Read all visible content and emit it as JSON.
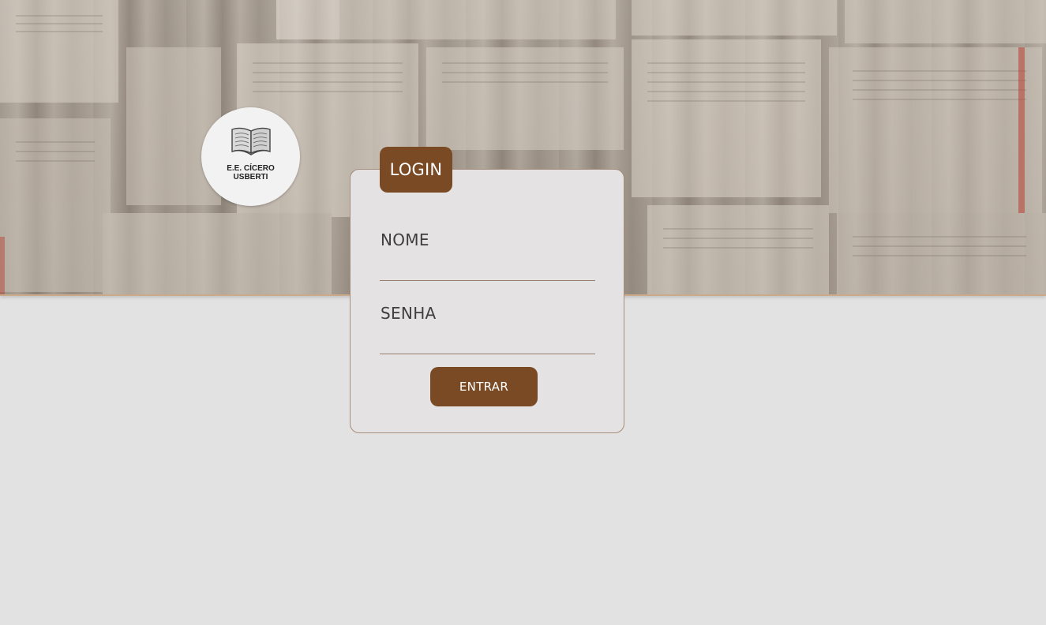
{
  "hero": {
    "background_icon": "open-books-photo"
  },
  "logo": {
    "icon": "open-book-icon",
    "line1": "E.E. CÍCERO",
    "line2": "USBERTI"
  },
  "login": {
    "tab_label": "LOGIN",
    "name_label": "NOME",
    "name_value": "",
    "password_label": "SENHA",
    "password_value": "",
    "submit_label": "ENTRAR"
  },
  "colors": {
    "accent": "#7a4a25",
    "page_background": "#e3e2e2",
    "card_border": "#a68c7a"
  }
}
